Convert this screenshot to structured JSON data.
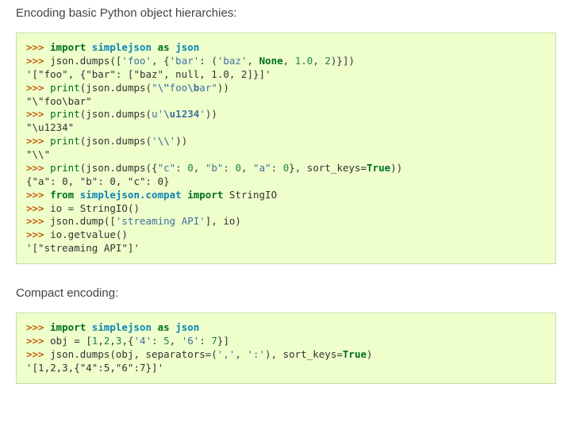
{
  "section1": {
    "title": "Encoding basic Python object hierarchies:",
    "code": {
      "l1": {
        "prompt": ">>> ",
        "kw_import": "import",
        "module": "simplejson",
        "kw_as": "as",
        "alias": "json"
      },
      "l2": {
        "prompt": ">>> ",
        "call": "json.dumps([",
        "s1": "'foo'",
        "sep1": ", {",
        "s2": "'bar'",
        "sep2": ": (",
        "s3": "'baz'",
        "sep3": ", ",
        "kw_none": "None",
        "sep4": ", ",
        "n1": "1.0",
        "sep5": ", ",
        "n2": "2",
        "close": ")}])"
      },
      "l3": {
        "output": "'[\"foo\", {\"bar\": [\"baz\", null, 1.0, 2]}]'"
      },
      "l4": {
        "prompt": ">>> ",
        "print": "print",
        "open": "(json.dumps(",
        "sq": "\"",
        "esc1": "\\\"",
        "mid": "foo",
        "esc2": "\\b",
        "mid2": "ar",
        "eq": "\"",
        "close": "))"
      },
      "l5": {
        "output": "\"\\\"foo\\bar\""
      },
      "l6": {
        "prompt": ">>> ",
        "print": "print",
        "open": "(json.dumps(",
        "pref": "u",
        "sq": "'",
        "esc": "\\u1234",
        "eq": "'",
        "close": "))"
      },
      "l7": {
        "output": "\"\\u1234\""
      },
      "l8": {
        "prompt": ">>> ",
        "print": "print",
        "open": "(json.dumps(",
        "sq": "'",
        "esc": "\\\\",
        "eq": "'",
        "close": "))"
      },
      "l9": {
        "output": "\"\\\\\""
      },
      "l10": {
        "prompt": ">>> ",
        "print": "print",
        "open": "(json.dumps({",
        "s1": "\"c\"",
        "c1": ": ",
        "n1": "0",
        "c2": ", ",
        "s2": "\"b\"",
        "c3": ": ",
        "n2": "0",
        "c4": ", ",
        "s3": "\"a\"",
        "c5": ": ",
        "n3": "0",
        "close1": "}, sort_keys=",
        "kw_true": "True",
        "close2": "))"
      },
      "l11": {
        "output": "{\"a\": 0, \"b\": 0, \"c\": 0}"
      },
      "l12": {
        "prompt": ">>> ",
        "kw_from": "from",
        "module": "simplejson.compat",
        "kw_import": "import",
        "name": "StringIO"
      },
      "l13": {
        "prompt": ">>> ",
        "text": "io = StringIO()"
      },
      "l14": {
        "prompt": ">>> ",
        "text1": "json.dump([",
        "s1": "'streaming API'",
        "text2": "], io)"
      },
      "l15": {
        "prompt": ">>> ",
        "text": "io.getvalue()"
      },
      "l16": {
        "output": "'[\"streaming API\"]'"
      }
    }
  },
  "section2": {
    "title": "Compact encoding:",
    "code": {
      "l1": {
        "prompt": ">>> ",
        "kw_import": "import",
        "module": "simplejson",
        "kw_as": "as",
        "alias": "json"
      },
      "l2": {
        "prompt": ">>> ",
        "t1": "obj = [",
        "n1": "1",
        "c1": ",",
        "n2": "2",
        "c2": ",",
        "n3": "3",
        "c3": ",{",
        "s1": "'4'",
        "c4": ": ",
        "n4": "5",
        "c5": ", ",
        "s2": "'6'",
        "c6": ": ",
        "n5": "7",
        "t2": "}]"
      },
      "l3": {
        "prompt": ">>> ",
        "t1": "json.dumps(obj, separators=(",
        "s1": "','",
        "c1": ", ",
        "s2": "':'",
        "t2": "), sort_keys=",
        "kw_true": "True",
        "t3": ")"
      },
      "l4": {
        "output": "'[1,2,3,{\"4\":5,\"6\":7}]'"
      }
    }
  }
}
